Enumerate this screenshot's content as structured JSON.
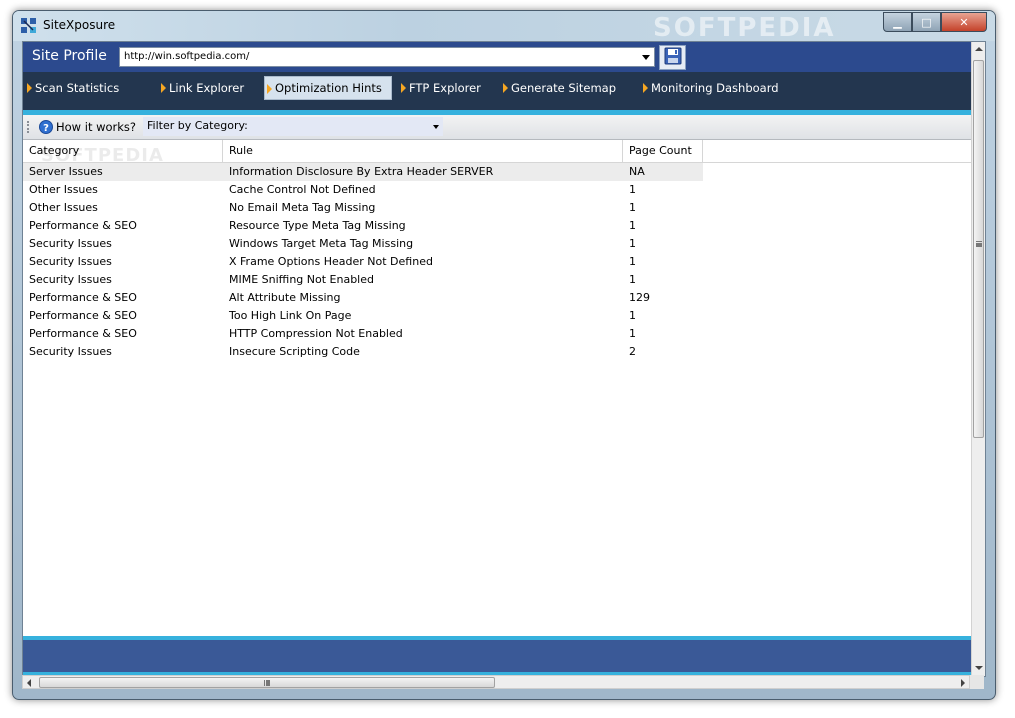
{
  "window": {
    "title": "SiteXposure",
    "watermark": "SOFTPEDIA",
    "minimize_glyph": "▁",
    "maximize_glyph": "□",
    "close_glyph": "✕"
  },
  "profile": {
    "label": "Site Profile",
    "url": "http://win.softpedia.com/"
  },
  "tabs": [
    {
      "label": "Scan Statistics"
    },
    {
      "label": "Link Explorer"
    },
    {
      "label": "Optimization Hints",
      "active": true
    },
    {
      "label": "FTP Explorer"
    },
    {
      "label": "Generate Sitemap"
    },
    {
      "label": "Monitoring Dashboard"
    }
  ],
  "toolbar": {
    "help_label": "How it works?",
    "filter_label": "Filter by Category:"
  },
  "grid": {
    "watermark": "SOFTPEDIA",
    "columns": [
      "Category",
      "Rule",
      "Page Count"
    ],
    "rows": [
      {
        "category": "Server Issues",
        "rule": "Information Disclosure By Extra Header SERVER",
        "count": "NA"
      },
      {
        "category": "Other Issues",
        "rule": "Cache Control Not Defined",
        "count": "1"
      },
      {
        "category": "Other Issues",
        "rule": "No Email Meta Tag Missing",
        "count": "1"
      },
      {
        "category": "Performance & SEO",
        "rule": "Resource Type Meta Tag Missing",
        "count": "1"
      },
      {
        "category": "Security Issues",
        "rule": "Windows Target Meta Tag Missing",
        "count": "1"
      },
      {
        "category": "Security Issues",
        "rule": "X Frame Options Header Not Defined",
        "count": "1"
      },
      {
        "category": "Security Issues",
        "rule": "MIME Sniffing Not Enabled",
        "count": "1"
      },
      {
        "category": "Performance & SEO",
        "rule": "Alt Attribute Missing",
        "count": "129"
      },
      {
        "category": "Performance & SEO",
        "rule": "Too High Link On Page",
        "count": "1"
      },
      {
        "category": "Performance & SEO",
        "rule": "HTTP Compression Not Enabled",
        "count": "1"
      },
      {
        "category": "Security Issues",
        "rule": "Insecure Scripting Code",
        "count": "2"
      }
    ]
  },
  "colors": {
    "profile_bar": "#2c4a8e",
    "tab_bar": "#23364f",
    "accent_strip": "#36b1dd",
    "tab_arrow": "#f5a623",
    "footer_band": "#3a5997"
  },
  "icons": {
    "app": "sitexposure-app-icon",
    "save": "save-disk-icon",
    "help": "help-question-icon"
  }
}
